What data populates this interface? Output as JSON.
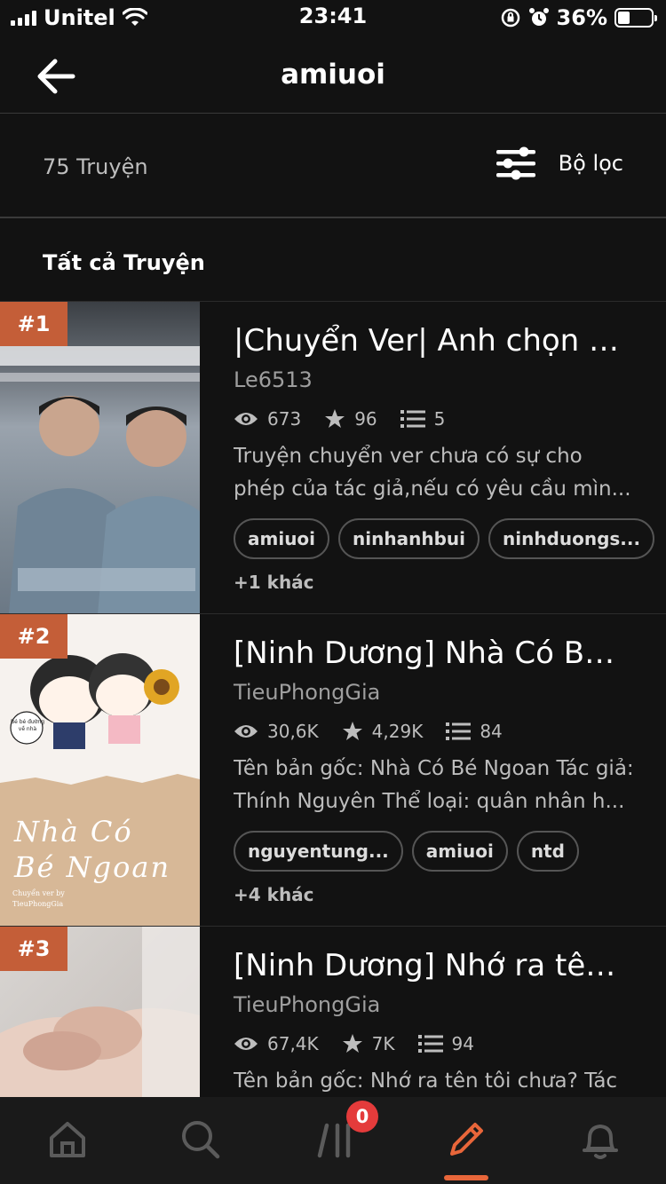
{
  "status": {
    "carrier": "Unitel",
    "time": "23:41",
    "battery": "36%",
    "battery_level": 0.36
  },
  "header": {
    "title": "amiuoi",
    "back_icon": "arrow-left-icon"
  },
  "filter": {
    "count_label": "75 Truyện",
    "filter_label": "Bộ lọc",
    "filter_icon": "sliders-icon"
  },
  "section": {
    "title": "Tất cả Truyện"
  },
  "stories": [
    {
      "rank": "#1",
      "title": "|Chuyển Ver| Anh chọn t...",
      "author": "Le6513",
      "views": "673",
      "votes": "96",
      "parts": "5",
      "desc_line1": "Truyện chuyển ver chưa có sự cho",
      "desc_line2": "phép của tác giả,nếu có yêu cầu mìn...",
      "tags": [
        "amiuoi",
        "ninhanhbui",
        "ninhduongs..."
      ],
      "more": "+1 khác"
    },
    {
      "rank": "#2",
      "title": "[Ninh Dương] Nhà Có Bé...",
      "author": "TieuPhongGia",
      "views": "30,6K",
      "votes": "4,29K",
      "parts": "84",
      "desc_line1": "Tên bản gốc: Nhà Có Bé Ngoan Tác giả:",
      "desc_line2": "Thính Nguyên Thể loại: quân nhân h...",
      "tags": [
        "nguyentung...",
        "amiuoi",
        "ntd"
      ],
      "more": "+4 khác",
      "cover_text1": "Nhà Có",
      "cover_text2": "Bé Ngoan",
      "cover_small": "Chuyển ver by",
      "cover_small2": "TieuPhongGia",
      "cover_bubble": "Bé bé đường về nhà"
    },
    {
      "rank": "#3",
      "title": "[Ninh Dương] Nhớ ra tên...",
      "author": "TieuPhongGia",
      "views": "67,4K",
      "votes": "7K",
      "parts": "94",
      "desc_line1": "Tên bản gốc: Nhớ ra tên tôi chưa?  Tác",
      "desc_line2": ""
    }
  ],
  "tabbar": {
    "items": [
      "home-icon",
      "search-icon",
      "library-icon",
      "write-icon",
      "notifications-icon"
    ],
    "active": "write-icon",
    "badge": "0",
    "accent": "#e8663a"
  }
}
